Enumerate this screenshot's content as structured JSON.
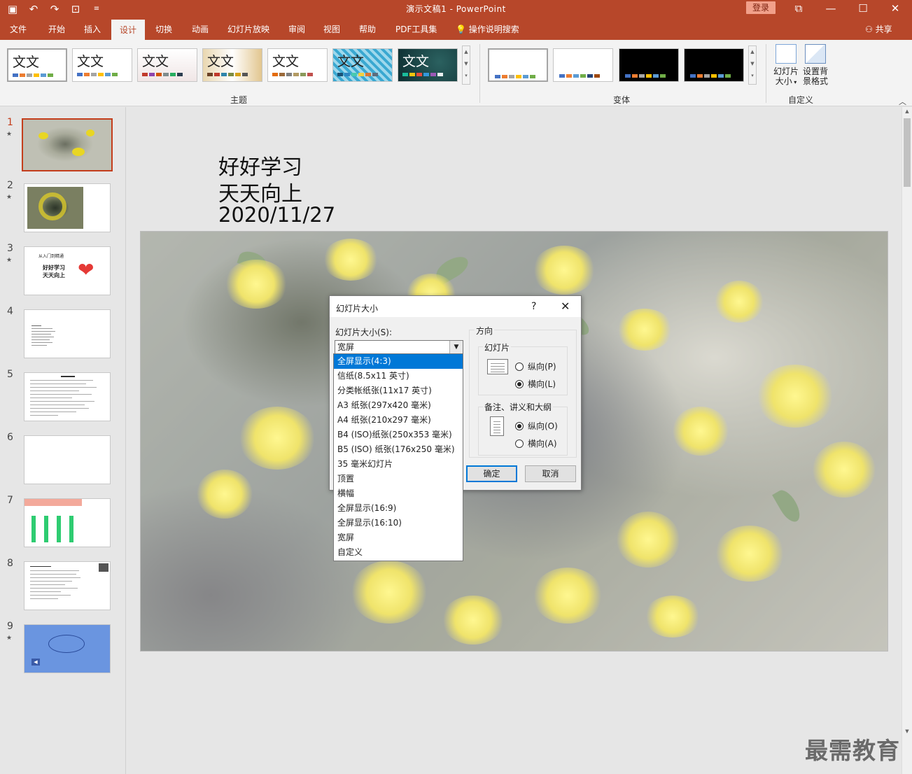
{
  "window": {
    "title": "演示文稿1 - PowerPoint",
    "login_label": "登录",
    "quick_access": [
      "save-icon",
      "undo-icon",
      "redo-icon",
      "present-icon",
      "customize-icon"
    ],
    "controls": [
      "ribbon-display-icon",
      "minimize-icon",
      "maximize-icon",
      "close-icon"
    ]
  },
  "tabs": {
    "file": "文件",
    "home": "开始",
    "insert": "插入",
    "design": "设计",
    "transitions": "切换",
    "animations": "动画",
    "slideshow": "幻灯片放映",
    "review": "审阅",
    "view": "视图",
    "help": "帮助",
    "pdf": "PDF工具集",
    "tellme": "操作说明搜索",
    "share": "共享"
  },
  "ribbon": {
    "themes_label": "主题",
    "variants_label": "变体",
    "customize_label": "自定义",
    "theme_text": "文文",
    "slide_size_label_1": "幻灯片",
    "slide_size_label_2": "大小",
    "format_bg_label_1": "设置背",
    "format_bg_label_2": "景格式",
    "colors": {
      "accent": "#b7472a"
    }
  },
  "slides": {
    "numbers": [
      "1",
      "2",
      "3",
      "4",
      "5",
      "6",
      "7",
      "8",
      "9"
    ],
    "thumb3_line1": "从入门到精通",
    "thumb3_line2": "好好学习",
    "thumb3_line3": "天天向上"
  },
  "slide": {
    "line1": "好好学习",
    "line2": "天天向上",
    "line3": "2020/11/27"
  },
  "dialog": {
    "title": "幻灯片大小",
    "help": "?",
    "close": "✕",
    "size_label": "幻灯片大小(S):",
    "size_value": "宽屏",
    "orientation_label": "方向",
    "slides_group": "幻灯片",
    "portrait_p": "纵向(P)",
    "landscape_l": "横向(L)",
    "notes_group": "备注、讲义和大纲",
    "portrait_o": "纵向(O)",
    "landscape_a": "横向(A)",
    "ok": "确定",
    "cancel": "取消",
    "options": [
      "全屏显示(4:3)",
      "信纸(8.5x11 英寸)",
      "分类帐纸张(11x17 英寸)",
      "A3 纸张(297x420 毫米)",
      "A4 纸张(210x297 毫米)",
      "B4 (ISO)纸张(250x353 毫米)",
      "B5 (ISO) 纸张(176x250 毫米)",
      "35 毫米幻灯片",
      "顶置",
      "横幅",
      "全屏显示(16:9)",
      "全屏显示(16:10)",
      "宽屏",
      "自定义"
    ]
  },
  "watermark": "最需教育"
}
